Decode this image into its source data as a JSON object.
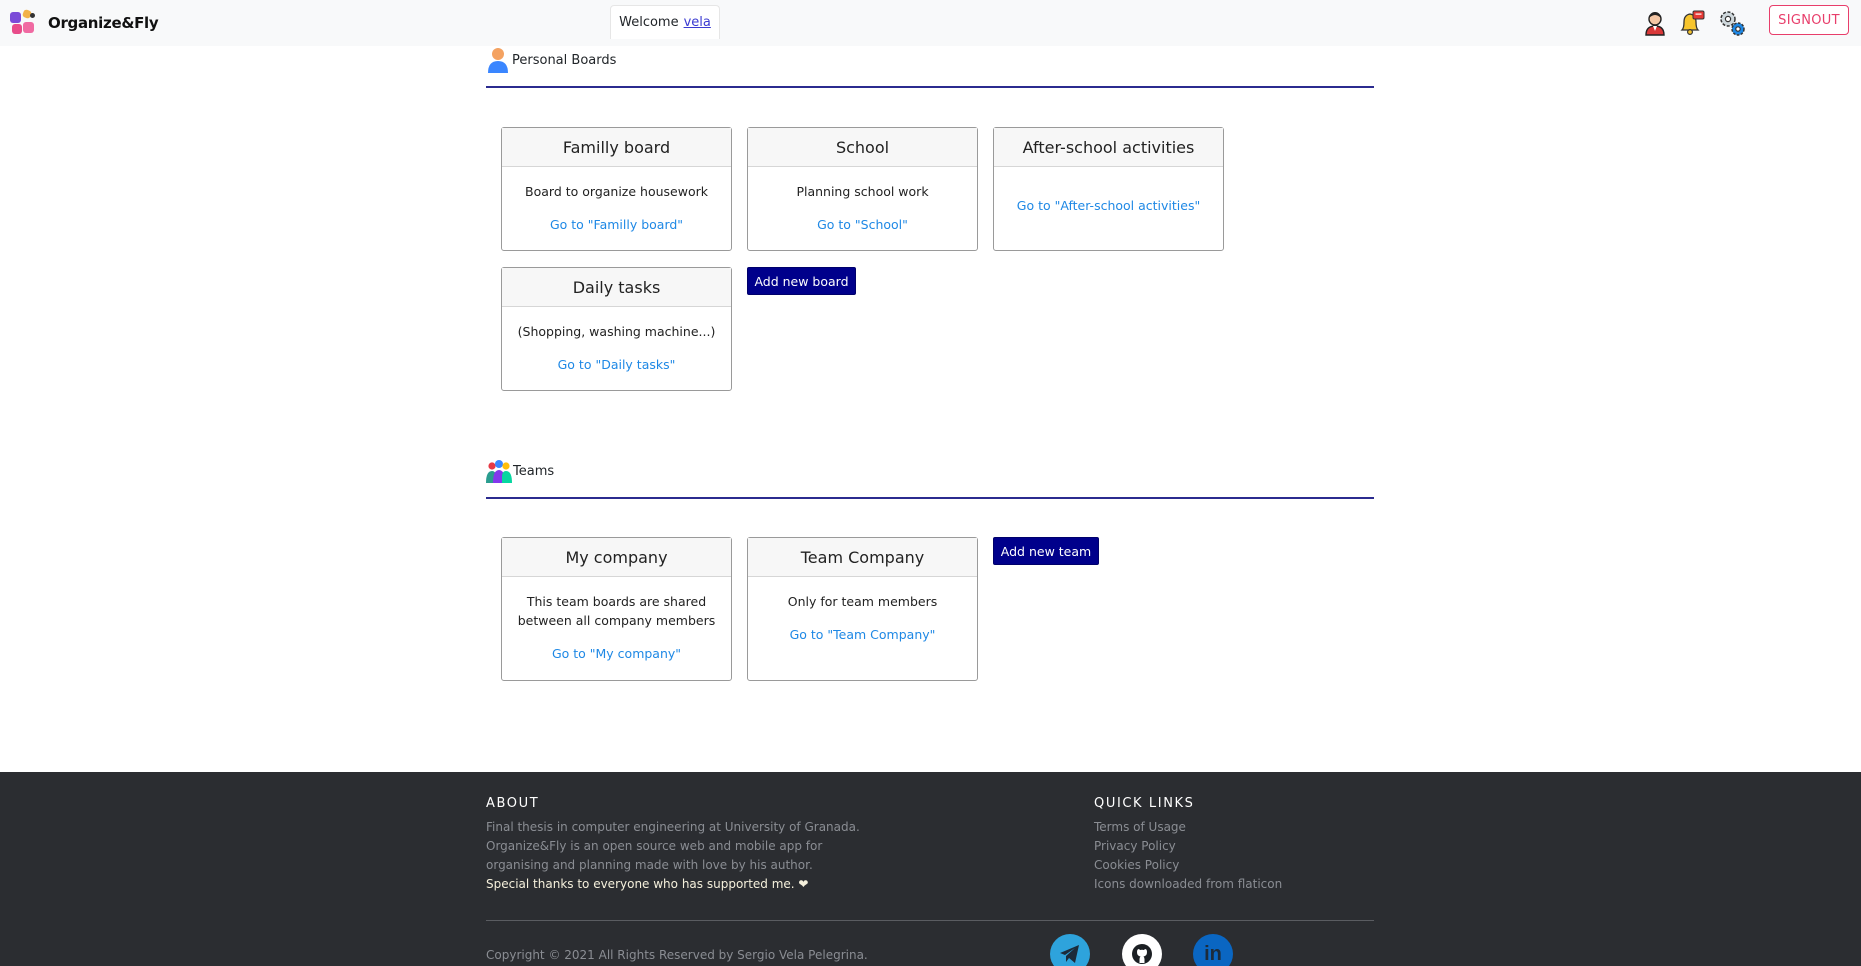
{
  "navbar": {
    "brand": "Organize&Fly",
    "welcome_prefix": "Welcome",
    "username": "vela",
    "signout_label": "SIGNOUT"
  },
  "personal": {
    "title": "Personal Boards",
    "boards": [
      {
        "title": "Familly board",
        "description": "Board to organize housework",
        "link": "Go to \"Familly board\""
      },
      {
        "title": "School",
        "description": "Planning school work",
        "link": "Go to \"School\""
      },
      {
        "title": "After-school activities",
        "description": "",
        "link": "Go to \"After-school activities\""
      },
      {
        "title": "Daily tasks",
        "description": "(Shopping, washing machine...)",
        "link": "Go to \"Daily tasks\""
      }
    ],
    "add_label": "Add new board"
  },
  "teams": {
    "title": "Teams",
    "items": [
      {
        "title": "My company",
        "description": "This team boards are shared between all company members",
        "link": "Go to \"My company\""
      },
      {
        "title": "Team Company",
        "description": "Only for team members",
        "link": "Go to \"Team Company\""
      }
    ],
    "add_label": "Add new team"
  },
  "footer": {
    "about_title": "ABOUT",
    "about_lines": [
      "Final thesis in computer engineering at University of Granada.",
      "Organize&Fly is an open source web and mobile app for",
      "organising and planning made with love by his author."
    ],
    "thanks": "Special thanks to everyone who has supported me. ❤",
    "quick_title": "QUICK LINKS",
    "links": [
      "Terms of Usage",
      "Privacy Policy",
      "Cookies Policy",
      "Icons downloaded from flaticon"
    ],
    "copyright": "Copyright © 2021 All Rights Reserved by Sergio Vela Pelegrina."
  },
  "colors": {
    "accent_dark_blue": "#00008b",
    "link_blue": "#1e88e5",
    "signout_pink": "#e83e6b",
    "footer_bg": "#2b2d31"
  },
  "icons": [
    "app-logo-icon",
    "user-avatar-icon",
    "notification-bell-icon",
    "settings-gears-icon",
    "personal-user-icon",
    "teams-group-icon",
    "telegram-icon",
    "github-icon",
    "linkedin-icon"
  ]
}
